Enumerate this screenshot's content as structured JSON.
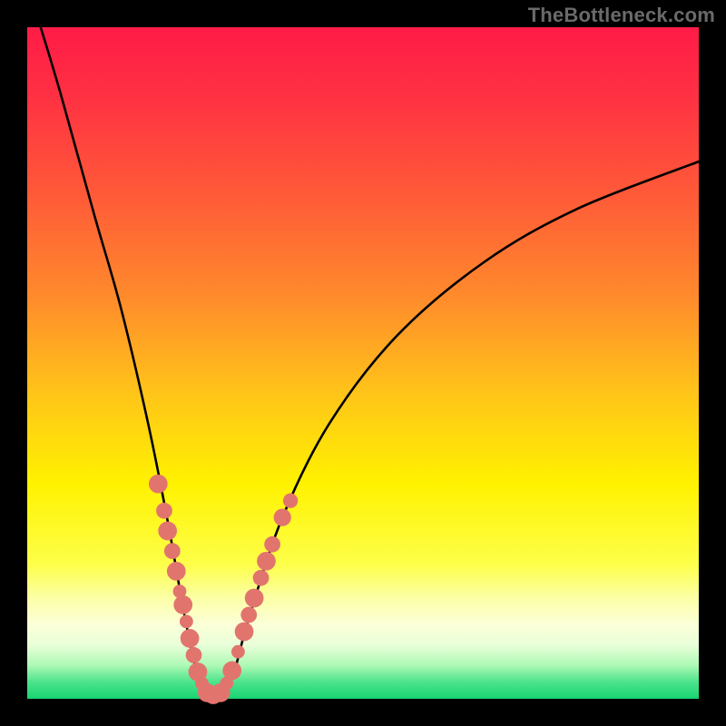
{
  "watermark": "TheBottleneck.com",
  "colors": {
    "bead": "#e2746e",
    "curve": "#000000",
    "frame": "#000000"
  },
  "gradient_stops": [
    {
      "offset": 0.0,
      "color": "#ff1b47"
    },
    {
      "offset": 0.1,
      "color": "#ff3043"
    },
    {
      "offset": 0.25,
      "color": "#ff5a38"
    },
    {
      "offset": 0.4,
      "color": "#ff8a2c"
    },
    {
      "offset": 0.55,
      "color": "#ffc618"
    },
    {
      "offset": 0.68,
      "color": "#fff200"
    },
    {
      "offset": 0.8,
      "color": "#fdff4a"
    },
    {
      "offset": 0.85,
      "color": "#fcffa6"
    },
    {
      "offset": 0.89,
      "color": "#fbffd8"
    },
    {
      "offset": 0.92,
      "color": "#e9ffd9"
    },
    {
      "offset": 0.95,
      "color": "#aef9b5"
    },
    {
      "offset": 0.975,
      "color": "#4de38c"
    },
    {
      "offset": 1.0,
      "color": "#18d472"
    }
  ],
  "chart_data": {
    "type": "line",
    "title": "",
    "xlabel": "",
    "ylabel": "",
    "x_range": [
      0,
      100
    ],
    "y_range": [
      0,
      100
    ],
    "note": "Axes are unlabeled in the source; x/y are normalized 0–100. Curve runs from top-left into a V-shaped valley near x≈27 where y bottoms out at ≈0, then rises toward the upper right. Discrete bead markers sit on both flanks of the valley. Vertical background gradient goes red→orange→yellow→pale→green from top to bottom.",
    "series": [
      {
        "name": "bottleneck-curve",
        "points": [
          {
            "x": 2.0,
            "y": 100.0
          },
          {
            "x": 5.0,
            "y": 90.0
          },
          {
            "x": 10.0,
            "y": 72.0
          },
          {
            "x": 14.0,
            "y": 58.0
          },
          {
            "x": 18.0,
            "y": 41.0
          },
          {
            "x": 21.0,
            "y": 26.0
          },
          {
            "x": 23.5,
            "y": 12.0
          },
          {
            "x": 25.5,
            "y": 3.0
          },
          {
            "x": 27.0,
            "y": 0.3
          },
          {
            "x": 28.5,
            "y": 0.3
          },
          {
            "x": 30.5,
            "y": 3.0
          },
          {
            "x": 33.0,
            "y": 12.0
          },
          {
            "x": 38.0,
            "y": 27.0
          },
          {
            "x": 45.0,
            "y": 41.0
          },
          {
            "x": 55.0,
            "y": 54.0
          },
          {
            "x": 68.0,
            "y": 65.0
          },
          {
            "x": 82.0,
            "y": 73.0
          },
          {
            "x": 100.0,
            "y": 80.0
          }
        ]
      }
    ],
    "markers": [
      {
        "x": 19.5,
        "y": 32.0,
        "r": 1.4
      },
      {
        "x": 20.4,
        "y": 28.0,
        "r": 1.2
      },
      {
        "x": 20.9,
        "y": 25.0,
        "r": 1.4
      },
      {
        "x": 21.6,
        "y": 22.0,
        "r": 1.2
      },
      {
        "x": 22.2,
        "y": 19.0,
        "r": 1.4
      },
      {
        "x": 22.7,
        "y": 16.0,
        "r": 1.0
      },
      {
        "x": 23.2,
        "y": 14.0,
        "r": 1.4
      },
      {
        "x": 23.7,
        "y": 11.5,
        "r": 1.0
      },
      {
        "x": 24.2,
        "y": 9.0,
        "r": 1.4
      },
      {
        "x": 24.8,
        "y": 6.5,
        "r": 1.2
      },
      {
        "x": 25.4,
        "y": 4.0,
        "r": 1.4
      },
      {
        "x": 26.0,
        "y": 2.3,
        "r": 1.0
      },
      {
        "x": 26.8,
        "y": 0.9,
        "r": 1.4
      },
      {
        "x": 27.7,
        "y": 0.6,
        "r": 1.4
      },
      {
        "x": 28.8,
        "y": 0.9,
        "r": 1.4
      },
      {
        "x": 29.7,
        "y": 2.3,
        "r": 1.0
      },
      {
        "x": 30.5,
        "y": 4.2,
        "r": 1.4
      },
      {
        "x": 31.4,
        "y": 7.0,
        "r": 1.0
      },
      {
        "x": 32.3,
        "y": 10.0,
        "r": 1.4
      },
      {
        "x": 33.0,
        "y": 12.5,
        "r": 1.2
      },
      {
        "x": 33.8,
        "y": 15.0,
        "r": 1.4
      },
      {
        "x": 34.8,
        "y": 18.0,
        "r": 1.2
      },
      {
        "x": 35.6,
        "y": 20.5,
        "r": 1.4
      },
      {
        "x": 36.5,
        "y": 23.0,
        "r": 1.2
      },
      {
        "x": 38.0,
        "y": 27.0,
        "r": 1.3
      },
      {
        "x": 39.2,
        "y": 29.5,
        "r": 1.1
      }
    ]
  }
}
